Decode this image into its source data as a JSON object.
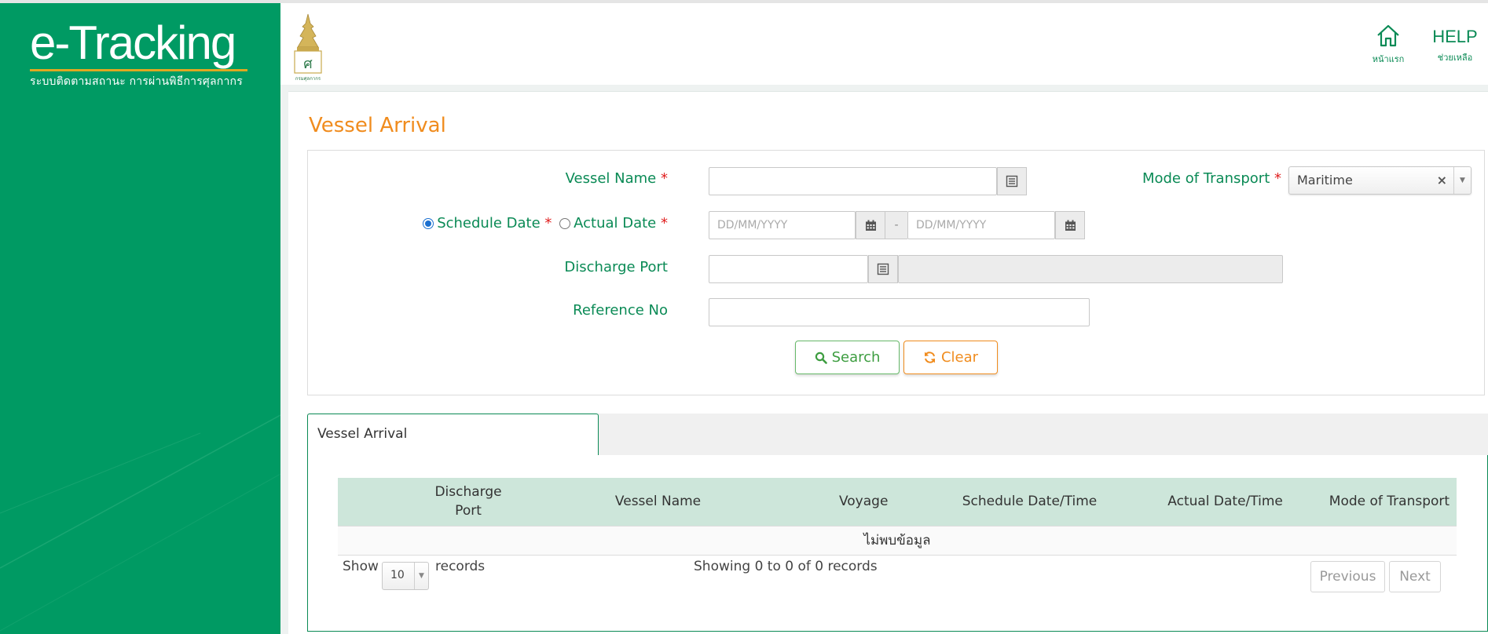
{
  "brand": {
    "logo_main": "e-Tracking",
    "logo_sub": "ระบบติดตามสถานะ การผ่านพิธีการศุลกากร",
    "emblem_text": "กรมศุลกากร"
  },
  "nav": {
    "home_label": "หน้าแรก",
    "help_big": "HELP",
    "help_label": "ช่วยเหลือ"
  },
  "page": {
    "title": "Vessel Arrival"
  },
  "form": {
    "vessel_name_label": "Vessel Name",
    "required_mark": "*",
    "mode_label": "Mode of Transport",
    "mode_value": "Maritime",
    "mode_clear": "×",
    "schedule_label": "Schedule Date",
    "actual_label": "Actual Date",
    "date_from_placeholder": "DD/MM/YYYY",
    "date_to_placeholder": "DD/MM/YYYY",
    "date_separator": "-",
    "discharge_label": "Discharge Port",
    "reference_label": "Reference No",
    "search_label": "Search",
    "clear_label": "Clear",
    "date_type_selected": "schedule"
  },
  "results": {
    "tab_label": "Vessel Arrival",
    "columns": [
      "",
      "Discharge Port",
      "Vessel Name",
      "Voyage",
      "Schedule Date/Time",
      "Actual Date/Time",
      "Mode of Transport"
    ],
    "empty_message": "ไม่พบข้อมูล",
    "show_label": "Show",
    "page_length": "10",
    "records_label": "records",
    "info": "Showing 0 to 0 of 0 records",
    "prev_label": "Previous",
    "next_label": "Next"
  },
  "colors": {
    "brand_green": "#009a63",
    "label_green": "#0a8a55",
    "title_orange": "#f08c1e",
    "header_row": "#cde6da"
  }
}
